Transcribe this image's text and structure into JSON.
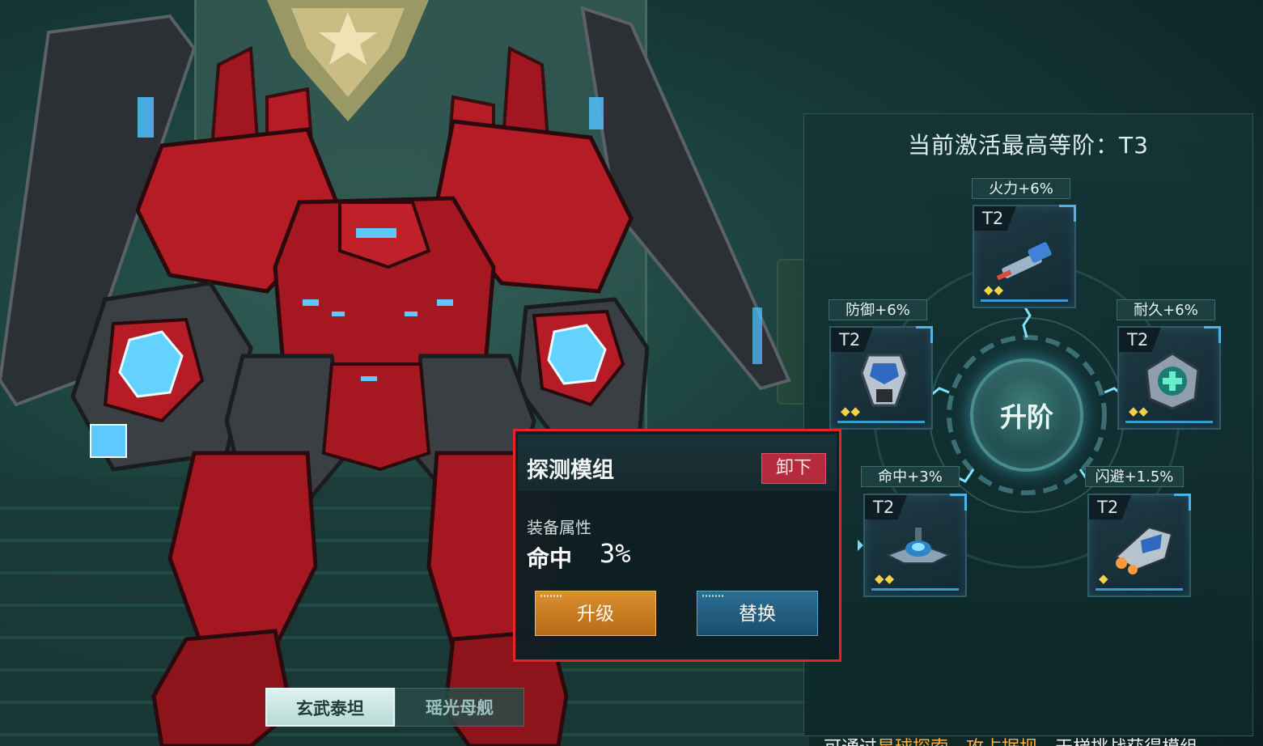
{
  "panel": {
    "title": "当前激活最高等阶：T3",
    "upgrade_label": "升阶",
    "slots": [
      {
        "id": "top",
        "tier": "T2",
        "bonus": "火力+6%",
        "stars": "◆◆"
      },
      {
        "id": "left",
        "tier": "T2",
        "bonus": "防御+6%",
        "stars": "◆◆"
      },
      {
        "id": "right",
        "tier": "T2",
        "bonus": "耐久+6%",
        "stars": "◆◆"
      },
      {
        "id": "bottom-left",
        "tier": "T2",
        "bonus": "命中+3%",
        "stars": "◆◆"
      },
      {
        "id": "bottom-right",
        "tier": "T2",
        "bonus": "闪避+1.5%",
        "stars": "◆"
      }
    ],
    "hint": {
      "prefix": "可通过",
      "highlight1": "星球探索",
      "sep": "、",
      "highlight2": "攻占据坝",
      "suffix": "、天梯挑战获得模组"
    }
  },
  "popup": {
    "title": "探测模组",
    "unequip_label": "卸下",
    "attr_label": "装备属性",
    "attr_name": "命中",
    "attr_value": "3%",
    "upgrade_label": "升级",
    "replace_label": "替换"
  },
  "tabs": [
    {
      "label": "玄武泰坦",
      "active": true
    },
    {
      "label": "瑶光母舰",
      "active": false
    }
  ],
  "colors": {
    "highlight_frame": "#e5232b",
    "upgrade_button": "#d9902e",
    "replace_button": "#2a6e94",
    "unequip_button": "#b52a3c",
    "star": "#f2d24a"
  }
}
